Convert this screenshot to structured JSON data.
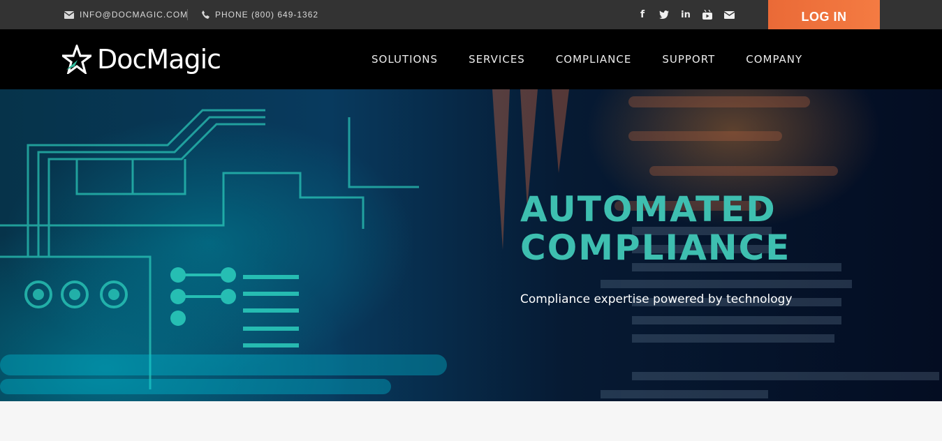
{
  "topbar": {
    "email": "INFO@DOCMAGIC.COM",
    "phone": "PHONE (800) 649-1362",
    "socials": [
      {
        "name": "facebook-icon",
        "glyph": "f"
      },
      {
        "name": "twitter-icon",
        "glyph": "t"
      },
      {
        "name": "linkedin-icon",
        "glyph": "in"
      },
      {
        "name": "youtube-icon",
        "glyph": "▶"
      },
      {
        "name": "mail-icon",
        "glyph": "✉"
      }
    ],
    "login_label": "LOG IN",
    "login_color": "#f27540"
  },
  "header": {
    "logo_text": "DocMagic",
    "nav": [
      "SOLUTIONS",
      "SERVICES",
      "COMPLIANCE",
      "SUPPORT",
      "COMPANY"
    ]
  },
  "hero": {
    "title_line1": "AUTOMATED",
    "title_line2": "COMPLIANCE",
    "subtitle": "Compliance expertise powered by technology",
    "accent_color": "#3ebfb0"
  }
}
